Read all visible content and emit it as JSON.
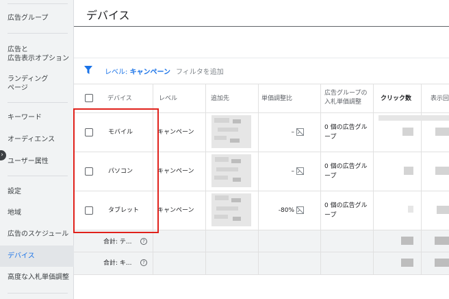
{
  "sidebar": {
    "items": [
      {
        "label": "広告グループ"
      },
      {
        "label": "広告と"
      },
      {
        "label": "広告表示オプション"
      },
      {
        "label": "ランディング"
      },
      {
        "label": "ページ"
      },
      {
        "label": "キーワード"
      },
      {
        "label": "オーディエンス"
      },
      {
        "label": "ユーザー属性"
      },
      {
        "label": "設定"
      },
      {
        "label": "地域"
      },
      {
        "label": "広告のスケジュール"
      },
      {
        "label": "デバイス"
      },
      {
        "label": "高度な入札単価調整"
      }
    ],
    "active_index": 11
  },
  "header": {
    "title": "デバイス"
  },
  "filter": {
    "level_prefix": "レベル: ",
    "level_value": "キャンペーン",
    "add_filter": "フィルタを追加"
  },
  "table": {
    "columns": [
      "デバイス",
      "レベル",
      "追加先",
      "単価調整比",
      "広告グループの",
      "入札単価調整",
      "クリック数",
      "表示回"
    ],
    "rows": [
      {
        "device": "モバイル",
        "level": "キャンペーン",
        "bid_adj": "–",
        "ag_line1": "0 個の広告グル",
        "ag_line2": "ープ"
      },
      {
        "device": "パソコン",
        "level": "キャンペーン",
        "bid_adj": "–",
        "ag_line1": "0 個の広告グル",
        "ag_line2": "ープ"
      },
      {
        "device": "タブレット",
        "level": "キャンペーン",
        "bid_adj": "-80%",
        "ag_line1": "0 個の広告グル",
        "ag_line2": "ープ"
      }
    ],
    "totals": [
      {
        "label": "合計: テ..."
      },
      {
        "label": "合計: キ..."
      }
    ]
  },
  "colors": {
    "accent": "#1a73e8",
    "highlight": "#e0201a"
  }
}
